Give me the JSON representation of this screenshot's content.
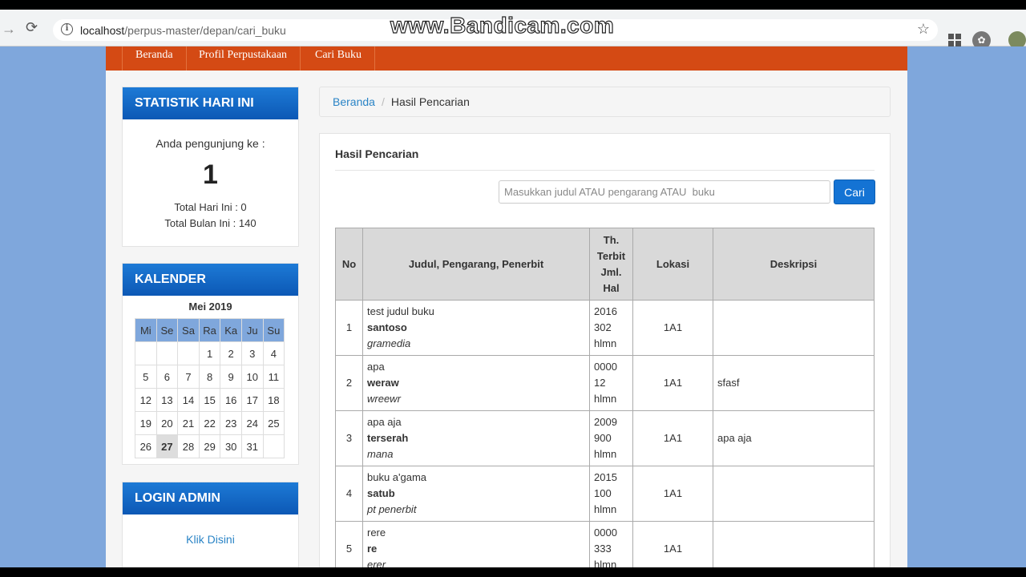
{
  "browser": {
    "url_host": "localhost",
    "url_path": "/perpus-master/depan/cari_buku",
    "watermark": "www.Bandicam.com",
    "info_icon_glyph": "i"
  },
  "nav": {
    "items": [
      "Beranda",
      "Profil Perpustakaan",
      "Cari Buku"
    ],
    "bar_color": "#d44a14"
  },
  "stats": {
    "title": "STATISTIK HARI INI",
    "visitor_label": "Anda pengunjung ke :",
    "visitor_number": "1",
    "total_today": "Total Hari Ini : 0",
    "total_month": "Total Bulan Ini : 140"
  },
  "calendar": {
    "title": "KALENDER",
    "month": "Mei 2019",
    "days": [
      "Mi",
      "Se",
      "Sa",
      "Ra",
      "Ka",
      "Ju",
      "Su"
    ],
    "weeks": [
      [
        "",
        "",
        "",
        "1",
        "2",
        "3",
        "4"
      ],
      [
        "5",
        "6",
        "7",
        "8",
        "9",
        "10",
        "11"
      ],
      [
        "12",
        "13",
        "14",
        "15",
        "16",
        "17",
        "18"
      ],
      [
        "19",
        "20",
        "21",
        "22",
        "23",
        "24",
        "25"
      ],
      [
        "26",
        "27",
        "28",
        "29",
        "30",
        "31",
        ""
      ]
    ],
    "today": "27"
  },
  "login": {
    "title": "LOGIN ADMIN",
    "link": "Klik Disini"
  },
  "breadcrumb": {
    "home": "Beranda",
    "separator": "/",
    "current": "Hasil Pencarian"
  },
  "search": {
    "heading": "Hasil Pencarian",
    "placeholder": "Masukkan judul ATAU pengarang ATAU  buku",
    "button": "Cari"
  },
  "table": {
    "headers": {
      "no": "No",
      "judul": "Judul, Pengarang, Penerbit",
      "th_lines": [
        "Th.",
        "Terbit",
        "Jml.",
        "Hal"
      ],
      "lokasi": "Lokasi",
      "deskripsi": "Deskripsi"
    },
    "rows": [
      {
        "no": "1",
        "title": "test judul buku",
        "author": "santoso",
        "publisher": "gramedia",
        "year": "2016",
        "pages": "302",
        "unit": "hlmn",
        "lokasi": "1A1",
        "deskripsi": ""
      },
      {
        "no": "2",
        "title": "apa",
        "author": "weraw",
        "publisher": "wreewr",
        "year": "0000",
        "pages": "12",
        "unit": "hlmn",
        "lokasi": "1A1",
        "deskripsi": "sfasf"
      },
      {
        "no": "3",
        "title": "apa aja",
        "author": "terserah",
        "publisher": "mana",
        "year": "2009",
        "pages": "900",
        "unit": "hlmn",
        "lokasi": "1A1",
        "deskripsi": "apa aja"
      },
      {
        "no": "4",
        "title": "buku a'gama",
        "author": "satub",
        "publisher": "pt penerbit",
        "year": "2015",
        "pages": "100",
        "unit": "hlmn",
        "lokasi": "1A1",
        "deskripsi": ""
      },
      {
        "no": "5",
        "title": "rere",
        "author": "re",
        "publisher": "erer",
        "year": "0000",
        "pages": "333",
        "unit": "hlmn",
        "lokasi": "1A1",
        "deskripsi": ""
      }
    ]
  }
}
